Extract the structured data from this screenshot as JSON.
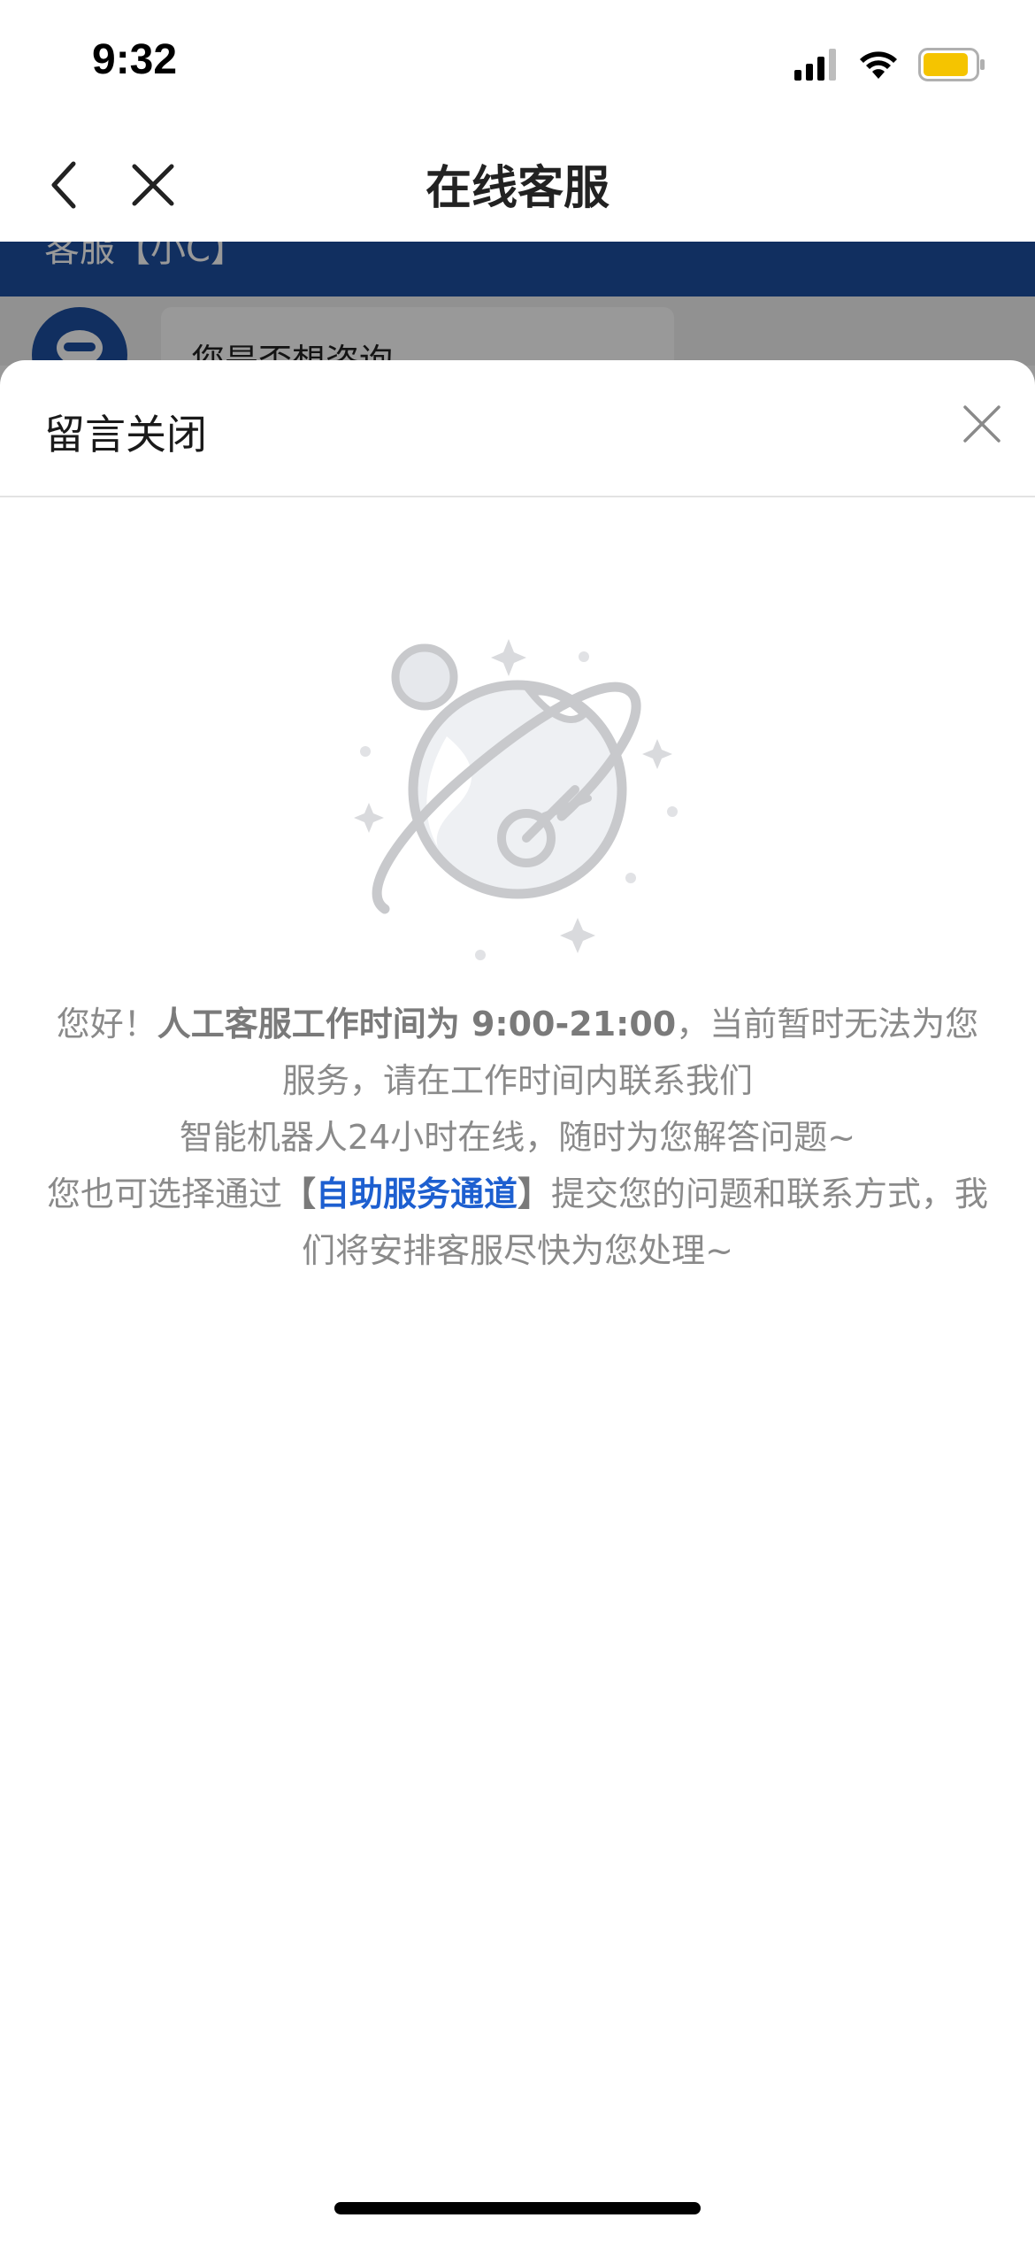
{
  "status_bar": {
    "time": "9:32",
    "icons": [
      "cellular-signal-icon",
      "wifi-icon",
      "battery-icon"
    ],
    "battery_color": "#f5c400"
  },
  "nav": {
    "title": "在线客服",
    "back_icon": "chevron-left-icon",
    "close_icon": "close-icon"
  },
  "background_chat": {
    "banner_text": "客服【小C】",
    "bubble_text": "您是否想咨询",
    "banner_color": "#1d4fa0"
  },
  "sheet": {
    "title": "留言关闭",
    "close_icon": "close-icon",
    "illustration": "globe-illustration-icon",
    "message": {
      "greeting": "您好！",
      "hours_label": "人工客服工作时间为 9:00-21:00",
      "line1_tail": "，当前暂时无法为您服务，请在工作时间内联系我们",
      "line2": "智能机器人24小时在线，随时为您解答问题~",
      "line3_prefix": "您也可选择通过",
      "bracket_open": "【",
      "link_text": "自助服务通道",
      "bracket_close": "】",
      "line3_suffix": "提交您的问题和联系方式，我们将安排客服尽快为您处理~"
    },
    "link_color": "#1d5fd0"
  }
}
